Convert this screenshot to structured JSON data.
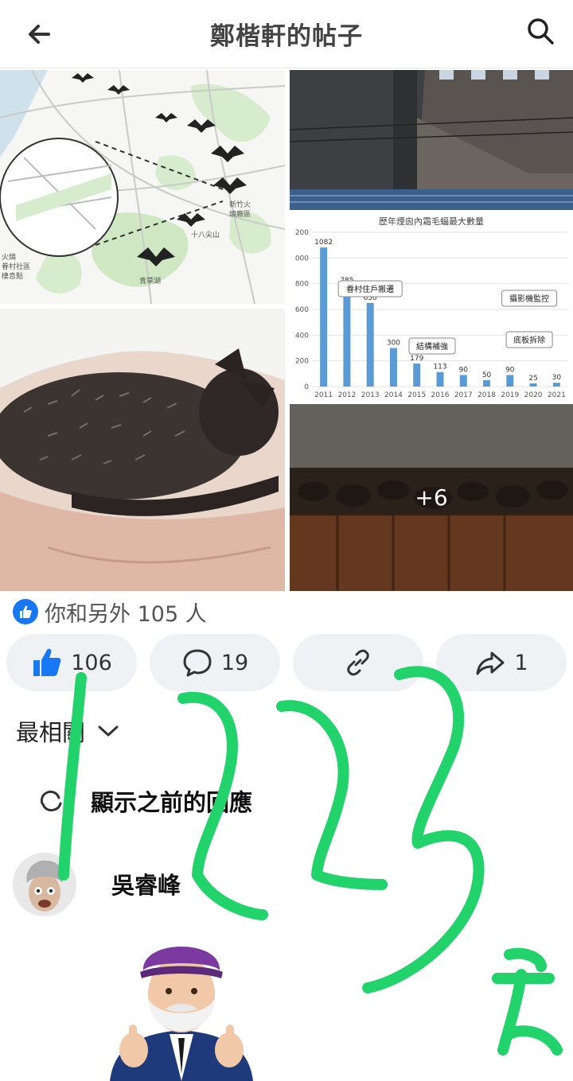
{
  "header": {
    "title": "鄭楷軒的帖子",
    "back_icon": "arrow-left-icon",
    "search_icon": "search-icon"
  },
  "photos": {
    "map": {
      "labels": [
        "新竹火",
        "燒廠區",
        "十八尖山",
        "青草湖",
        "火燒",
        "眷村社區",
        "棲息點"
      ]
    },
    "chart": {
      "overlay_label": "+6"
    },
    "more_label": "+6"
  },
  "chart_data": {
    "type": "bar",
    "title": "歷年煙囪內霜毛蝠最大數量",
    "categories": [
      "2011",
      "2012",
      "2013",
      "2014",
      "2015",
      "2016",
      "2017",
      "2018",
      "2019",
      "2020",
      "2021"
    ],
    "values": [
      1082,
      785,
      650,
      300,
      179,
      113,
      90,
      50,
      90,
      25,
      30
    ],
    "ylim": [
      0,
      1200
    ],
    "yticks": [
      "0",
      "200",
      "400",
      "600",
      "800",
      "1000",
      "1200"
    ],
    "ytick_labels": [
      "0",
      "200",
      "400",
      "600",
      "800",
      "000",
      "200"
    ],
    "annotations": [
      "眷村住戶搬遷",
      "結構補強",
      "攝影機監控",
      "底板拆除"
    ],
    "color": "#5b9bd5"
  },
  "reactions": {
    "text": "你和另外 105 人",
    "badge_icon": "thumbs-up-icon"
  },
  "actions": {
    "like_count": "106",
    "comment_count": "19",
    "share_count": "1",
    "like_icon": "thumbs-up-icon",
    "comment_icon": "comment-bubble-icon",
    "link_icon": "link-icon",
    "share_icon": "share-arrow-icon"
  },
  "sort": {
    "label": "最相關",
    "icon": "chevron-down-icon"
  },
  "previous_replies": {
    "label": "顯示之前的回應",
    "icon": "reply-refresh-icon"
  },
  "comment": {
    "author": "吳睿峰"
  },
  "colors": {
    "brand": "#1877f2",
    "doodle": "#22d36b",
    "button_bg": "#eff1f4"
  }
}
